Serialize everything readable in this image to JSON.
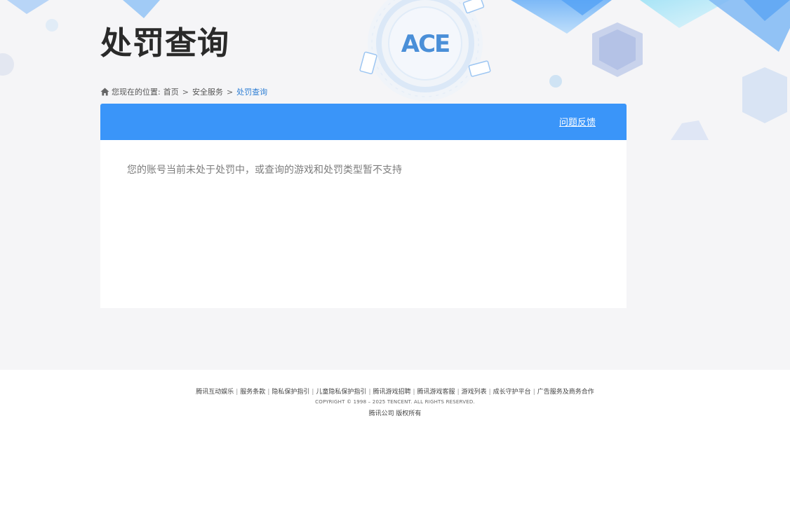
{
  "header": {
    "title": "处罚查询",
    "logo_text": "ACE"
  },
  "breadcrumb": {
    "prefix": "您现在的位置:",
    "items": [
      "首页",
      "安全服务",
      "处罚查询"
    ],
    "separator": ">"
  },
  "card": {
    "feedback_label": "问题反馈",
    "message": "您的账号当前未处于处罚中，或查询的游戏和处罚类型暂不支持"
  },
  "footer": {
    "links": [
      "腾讯互动娱乐",
      "服务条款",
      "隐私保护指引",
      "儿童隐私保护指引",
      "腾讯游戏招聘",
      "腾讯游戏客服",
      "游戏列表",
      "成长守护平台",
      "广告服务及商务合作"
    ],
    "link_separator": "|",
    "copyright": "COPYRIGHT © 1998 – 2025 TENCENT. ALL RIGHTS RESERVED.",
    "company": "腾讯公司 版权所有"
  },
  "icons": {
    "home": "home-icon"
  },
  "colors": {
    "accent_blue": "#3a95f9",
    "breadcrumb_current": "#2f7fd4",
    "title": "#2a2a2a",
    "page_bg": "#f5f5f7"
  }
}
